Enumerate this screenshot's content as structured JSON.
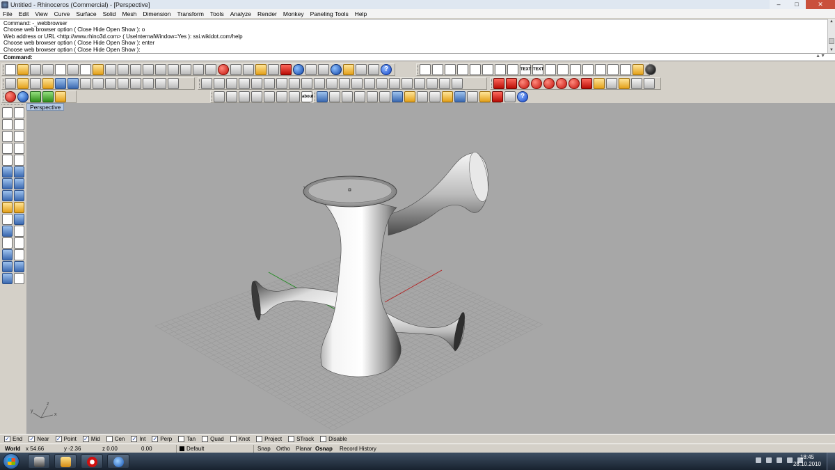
{
  "window": {
    "title": "Untitled - Rhinoceros (Commercial) - [Perspective]",
    "min_label": "–",
    "max_label": "□",
    "close_label": "✕"
  },
  "menu": [
    "File",
    "Edit",
    "View",
    "Curve",
    "Surface",
    "Solid",
    "Mesh",
    "Dimension",
    "Transform",
    "Tools",
    "Analyze",
    "Render",
    "Monkey",
    "Paneling Tools",
    "Help"
  ],
  "command_history": [
    "Command: -_webbrowser",
    "Choose web browser option ( Close  Hide  Open  Show ): o",
    "Web address or URL <http://www.rhino3d.com> ( UseInternalWindow=Yes ): ssi.wikidot.com/help",
    "Choose web browser option ( Close  Hide  Open  Show ): enter",
    "Choose web browser option ( Close  Hide  Open  Show ):"
  ],
  "command_line": {
    "prompt": "Command:",
    "value": ""
  },
  "toolbar_text_icons": {
    "text1": "TEXT",
    "text2": "TEXT",
    "about": "about"
  },
  "viewport": {
    "label": "Perspective",
    "axis_x": "x",
    "axis_y": "y",
    "axis_z": "z"
  },
  "osnap": [
    {
      "label": "End",
      "checked": true
    },
    {
      "label": "Near",
      "checked": true
    },
    {
      "label": "Point",
      "checked": true
    },
    {
      "label": "Mid",
      "checked": true
    },
    {
      "label": "Cen",
      "checked": false
    },
    {
      "label": "Int",
      "checked": true
    },
    {
      "label": "Perp",
      "checked": true
    },
    {
      "label": "Tan",
      "checked": false
    },
    {
      "label": "Quad",
      "checked": false
    },
    {
      "label": "Knot",
      "checked": false
    },
    {
      "label": "Project",
      "checked": false
    },
    {
      "label": "STrack",
      "checked": false
    },
    {
      "label": "Disable",
      "checked": false
    }
  ],
  "status": {
    "cplane": "World",
    "x": "x 54.66",
    "y": "y -2.36",
    "z": "z 0.00",
    "d": "0.00",
    "layer": "Default",
    "snap": "Snap",
    "ortho": "Ortho",
    "planar": "Planar",
    "osnap": "Osnap",
    "record_history": "Record History"
  },
  "taskbar": {
    "time": "18:45",
    "date": "28.10.2010"
  },
  "colors": {
    "viewport_bg": "#a7a7a7",
    "grid": "#9a9a9a",
    "axis_x": "#b32020",
    "axis_y": "#1e8a1e"
  }
}
